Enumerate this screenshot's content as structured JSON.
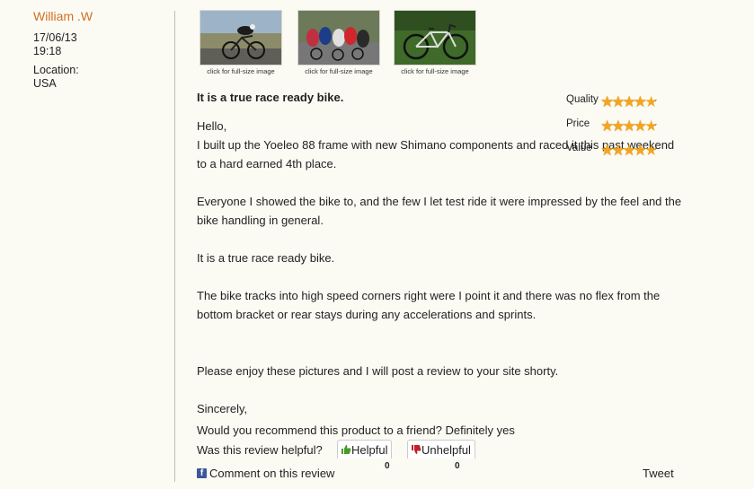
{
  "reviewer": {
    "name": "William .W",
    "date": "17/06/13",
    "time": "19:18",
    "location_label": "Location:",
    "location": "USA"
  },
  "images": [
    {
      "caption": "click for full-size image",
      "subject": "time-trial-rider-photo"
    },
    {
      "caption": "click for full-size image",
      "subject": "peloton-race-photo"
    },
    {
      "caption": "click for full-size image",
      "subject": "bike-on-grass-photo"
    }
  ],
  "review": {
    "title": "It is a true race ready bike.",
    "paragraphs": [
      "Hello,",
      "I built up the Yoeleo 88 frame with new Shimano components and raced it this past weekend to a hard earned 4th place.",
      "",
      "Everyone I showed the bike to, and the few I let test ride it were impressed by the feel and the bike handling in general.",
      "",
      "It is a true race ready bike.",
      "",
      "The bike tracks into high speed corners right were I point it and there was no flex from the bottom bracket or rear stays during any accelerations and sprints.",
      "",
      "",
      "Please enjoy these pictures and I will post a review to your site shorty.",
      "",
      "Sincerely,"
    ]
  },
  "ratings": [
    {
      "label": "Quality",
      "stars": 4.8,
      "max": 5
    },
    {
      "label": "Price",
      "stars": 4.8,
      "max": 5
    },
    {
      "label": "Value",
      "stars": 4.8,
      "max": 5
    }
  ],
  "recommend_text": "Would you recommend this product to a friend? Definitely yes",
  "helpful": {
    "question": "Was this review helpful?",
    "helpful_label": "Helpful",
    "helpful_count": "0",
    "unhelpful_label": "Unhelpful",
    "unhelpful_count": "0"
  },
  "comment_link": "Comment on this review",
  "tweet_link": "Tweet",
  "colors": {
    "author": "#d07020",
    "star": "#f4a41d",
    "facebook": "#3b5998",
    "thumbs_up": "#4a9a2a",
    "thumbs_down": "#c0202a"
  }
}
